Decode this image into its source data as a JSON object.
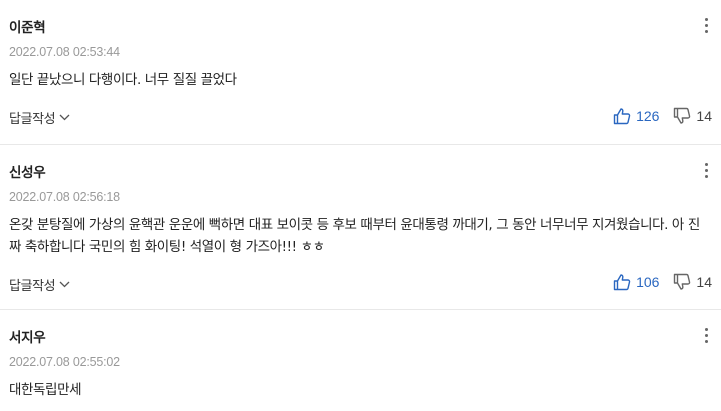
{
  "comments": [
    {
      "author": "이준혁",
      "date": "2022.07.08 02:53:44",
      "text": "일단 끝났으니 다행이다. 너무 질질 끌었다",
      "reply_label": "답글작성",
      "likes": "126",
      "dislikes": "14"
    },
    {
      "author": "신성우",
      "date": "2022.07.08 02:56:18",
      "text": "온갖 분탕질에 가상의 윤핵관 운운에 뻑하면 대표 보이콧 등 후보 때부터 윤대통령 까대기, 그 동안 너무너무 지겨웠습니다. 아 진짜 축하합니다 국민의 힘 화이팅! 석열이 형 가즈아!!! ㅎㅎ",
      "reply_label": "답글작성",
      "likes": "106",
      "dislikes": "14"
    },
    {
      "author": "서지우",
      "date": "2022.07.08 02:55:02",
      "text": "대한독립만세"
    }
  ],
  "colors": {
    "like": "#2a67c0",
    "date": "#999999",
    "divider": "#e8e8e8"
  },
  "icons": {
    "like": "thumbs-up-icon",
    "dislike": "thumbs-down-icon",
    "reply_toggle": "chevron-down-icon",
    "more": "more-vertical-icon"
  }
}
